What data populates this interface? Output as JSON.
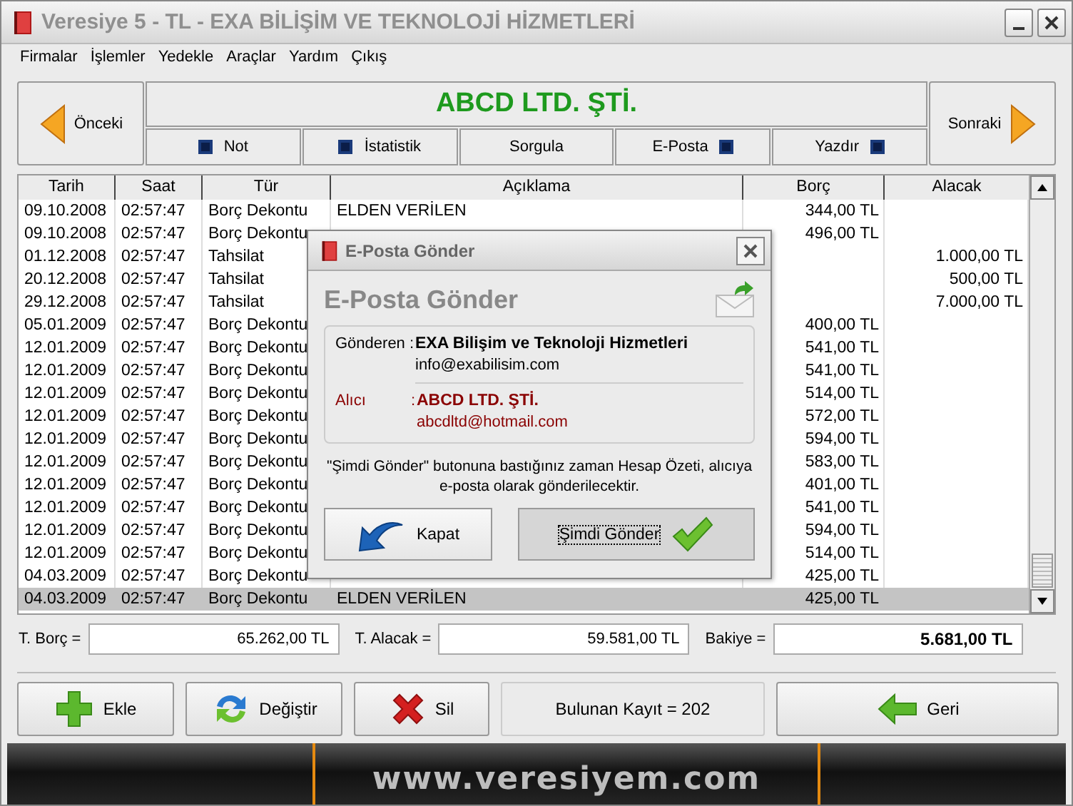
{
  "window": {
    "title": "Veresiye 5 - TL - EXA BİLİŞİM VE TEKNOLOJİ HİZMETLERİ"
  },
  "menu": [
    "Firmalar",
    "İşlemler",
    "Yedekle",
    "Araçlar",
    "Yardım",
    "Çıkış"
  ],
  "navigator": {
    "previous": "Önceki",
    "next": "Sonraki",
    "company": "ABCD LTD. ŞTİ.",
    "actions": [
      {
        "label": "Not",
        "icon_before": true,
        "icon_after": false
      },
      {
        "label": "İstatistik",
        "icon_before": true,
        "icon_after": false
      },
      {
        "label": "Sorgula",
        "icon_before": false,
        "icon_after": false
      },
      {
        "label": "E-Posta",
        "icon_before": false,
        "icon_after": true
      },
      {
        "label": "Yazdır",
        "icon_before": false,
        "icon_after": true
      }
    ]
  },
  "table": {
    "columns": [
      "Tarih",
      "Saat",
      "Tür",
      "Açıklama",
      "Borç",
      "Alacak"
    ],
    "rows": [
      {
        "date": "09.10.2008",
        "time": "02:57:47",
        "type": "Borç Dekontu",
        "description": "ELDEN VERİLEN",
        "debit": "344,00 TL",
        "selected": false
      },
      {
        "date": "09.10.2008",
        "time": "02:57:47",
        "type": "Borç Dekontu",
        "debit": "496,00 TL",
        "selected": false
      },
      {
        "date": "01.12.2008",
        "time": "02:57:47",
        "type": "Tahsilat",
        "credit": "1.000,00 TL",
        "selected": false
      },
      {
        "date": "20.12.2008",
        "time": "02:57:47",
        "type": "Tahsilat",
        "credit": "500,00 TL",
        "selected": false
      },
      {
        "date": "29.12.2008",
        "time": "02:57:47",
        "type": "Tahsilat",
        "credit": "7.000,00 TL",
        "selected": false
      },
      {
        "date": "05.01.2009",
        "time": "02:57:47",
        "type": "Borç Dekontu",
        "debit": "400,00 TL",
        "selected": false
      },
      {
        "date": "12.01.2009",
        "time": "02:57:47",
        "type": "Borç Dekontu",
        "debit": "541,00 TL",
        "selected": false
      },
      {
        "date": "12.01.2009",
        "time": "02:57:47",
        "type": "Borç Dekontu",
        "debit": "541,00 TL",
        "selected": false
      },
      {
        "date": "12.01.2009",
        "time": "02:57:47",
        "type": "Borç Dekontu",
        "debit": "514,00 TL",
        "selected": false
      },
      {
        "date": "12.01.2009",
        "time": "02:57:47",
        "type": "Borç Dekontu",
        "debit": "572,00 TL",
        "selected": false
      },
      {
        "date": "12.01.2009",
        "time": "02:57:47",
        "type": "Borç Dekontu",
        "debit": "594,00 TL",
        "selected": false
      },
      {
        "date": "12.01.2009",
        "time": "02:57:47",
        "type": "Borç Dekontu",
        "debit": "583,00 TL",
        "selected": false
      },
      {
        "date": "12.01.2009",
        "time": "02:57:47",
        "type": "Borç Dekontu",
        "debit": "401,00 TL",
        "selected": false
      },
      {
        "date": "12.01.2009",
        "time": "02:57:47",
        "type": "Borç Dekontu",
        "debit": "541,00 TL",
        "selected": false
      },
      {
        "date": "12.01.2009",
        "time": "02:57:47",
        "type": "Borç Dekontu",
        "debit": "594,00 TL",
        "selected": false
      },
      {
        "date": "12.01.2009",
        "time": "02:57:47",
        "type": "Borç Dekontu",
        "debit": "514,00 TL",
        "selected": false
      },
      {
        "date": "04.03.2009",
        "time": "02:57:47",
        "type": "Borç Dekontu",
        "debit": "425,00 TL",
        "selected": false
      },
      {
        "date": "04.03.2009",
        "time": "02:57:47",
        "type": "Borç Dekontu",
        "description": "ELDEN VERİLEN",
        "debit": "425,00 TL",
        "selected": true
      }
    ]
  },
  "totals": [
    {
      "label": "T. Borç =",
      "value": "65.262,00 TL",
      "bold": false
    },
    {
      "label": "T. Alacak =",
      "value": "59.581,00 TL",
      "bold": false
    },
    {
      "label": "Bakiye =",
      "value": "5.681,00 TL",
      "bold": true
    }
  ],
  "buttons": [
    {
      "kind": "add",
      "label": "Ekle"
    },
    {
      "kind": "edit",
      "label": "Değiştir"
    },
    {
      "kind": "delete",
      "label": "Sil"
    }
  ],
  "record_count": "Bulunan Kayıt = 202",
  "back_button": {
    "kind": "back",
    "label": "Geri"
  },
  "banner": "www.veresiyem.com",
  "dialog": {
    "title": "E-Posta Gönder",
    "heading": "E-Posta Gönder",
    "sender": {
      "label": "Gönderen :",
      "name": "EXA Bilişim ve Teknoloji Hizmetleri",
      "email": "info@exabilisim.com"
    },
    "recipient": {
      "label": "Alıcı",
      "separator": ":",
      "name": "ABCD LTD. ŞTİ.",
      "email": "abcdltd@hotmail.com"
    },
    "message": "\"Şimdi Gönder\" butonuna bastığınız zaman Hesap Özeti, alıcıya e-posta olarak gönderilecektir.",
    "buttons": [
      {
        "kind": "close",
        "label": "Kapat",
        "focused": false
      },
      {
        "kind": "send",
        "label": "Şimdi Gönder",
        "focused": true
      }
    ]
  }
}
